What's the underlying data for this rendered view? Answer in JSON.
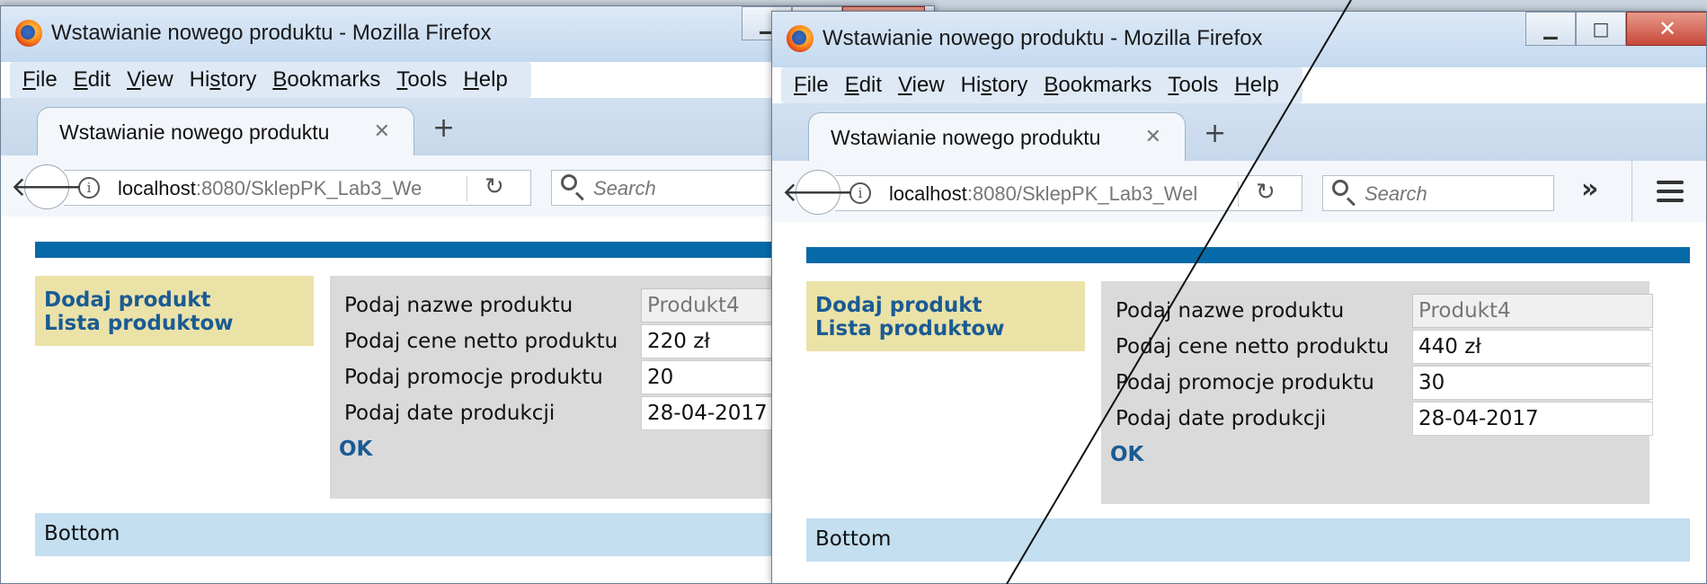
{
  "left": {
    "window_title": "Wstawianie nowego produktu - Mozilla Firefox",
    "menu": {
      "file": {
        "u": "F",
        "rest": "ile"
      },
      "edit": {
        "u": "E",
        "rest": "dit"
      },
      "view": {
        "u": "V",
        "rest": "iew"
      },
      "history": {
        "pre": "Hi",
        "u": "s",
        "rest": "tory"
      },
      "bookmarks": {
        "u": "B",
        "rest": "ookmarks"
      },
      "tools": {
        "u": "T",
        "rest": "ools"
      },
      "help": {
        "u": "H",
        "rest": "elp"
      }
    },
    "tab_title": "Wstawianie nowego produktu",
    "url_host": "localhost",
    "url_path": ":8080/SklepPK_Lab3_We",
    "search_placeholder": "Search",
    "nav_links": [
      "Dodaj produkt",
      "Lista produktow"
    ],
    "form": {
      "name_label": "Podaj nazwe produktu",
      "name_value": "Produkt4",
      "price_label": "Podaj cene netto produktu",
      "price_value": "220 zł",
      "promo_label": "Podaj promocje produktu",
      "promo_value": "20",
      "date_label": "Podaj date produkcji",
      "date_value": "28-04-2017",
      "ok_label": "OK"
    },
    "bottom_text": "Bottom"
  },
  "right": {
    "window_title": "Wstawianie nowego produktu - Mozilla Firefox",
    "menu": {
      "file": {
        "u": "F",
        "rest": "ile"
      },
      "edit": {
        "u": "E",
        "rest": "dit"
      },
      "view": {
        "u": "V",
        "rest": "iew"
      },
      "history": {
        "pre": "Hi",
        "u": "s",
        "rest": "tory"
      },
      "bookmarks": {
        "u": "B",
        "rest": "ookmarks"
      },
      "tools": {
        "u": "T",
        "rest": "ools"
      },
      "help": {
        "u": "H",
        "rest": "elp"
      }
    },
    "tab_title": "Wstawianie nowego produktu",
    "url_host": "localhost",
    "url_path": ":8080/SklepPK_Lab3_Wel",
    "search_placeholder": "Search",
    "nav_links": [
      "Dodaj produkt",
      "Lista produktow"
    ],
    "form": {
      "name_label": "Podaj nazwe produktu",
      "name_value": "Produkt4",
      "price_label": "Podaj cene netto produktu",
      "price_value": "440 zł",
      "promo_label": "Podaj promocje produktu",
      "promo_value": "30",
      "date_label": "Podaj date produkcji",
      "date_value": "28-04-2017",
      "ok_label": "OK"
    },
    "bottom_text": "Bottom"
  },
  "colors": {
    "header_bar": "#076aa8",
    "menu_panel": "#ebe2a8",
    "form_panel": "#dadada",
    "bottom_bar": "#c3dff0",
    "link": "#1a5b93"
  }
}
